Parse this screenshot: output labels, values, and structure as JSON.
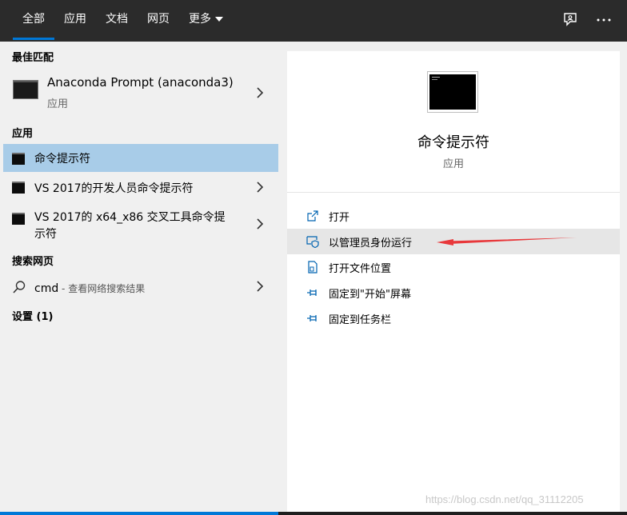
{
  "tabs": [
    {
      "label": "全部",
      "active": true
    },
    {
      "label": "应用"
    },
    {
      "label": "文档"
    },
    {
      "label": "网页"
    },
    {
      "label": "更多"
    }
  ],
  "header_icons": [
    "feedback-icon",
    "more-options-icon"
  ],
  "best_match": {
    "title": "最佳匹配",
    "item": {
      "name": "Anaconda Prompt (anaconda3)",
      "type": "应用",
      "icon": "terminal-icon"
    }
  },
  "apps": {
    "title": "应用",
    "items": [
      {
        "name": "命令提示符",
        "selected": true
      },
      {
        "name": "VS 2017的开发人员命令提示符"
      },
      {
        "name_line1": "VS 2017的 x64_x86 交叉工具命令提",
        "name_line2": "示符"
      }
    ]
  },
  "web": {
    "title": "搜索网页",
    "query": "cmd",
    "suffix": " - 查看网络搜索结果"
  },
  "settings": {
    "title": "设置 (1)"
  },
  "preview": {
    "name": "命令提示符",
    "type": "应用"
  },
  "actions": [
    {
      "label": "打开",
      "icon": "open-icon"
    },
    {
      "label": "以管理员身份运行",
      "icon": "shield-icon",
      "highlighted": true
    },
    {
      "label": "打开文件位置",
      "icon": "file-location-icon"
    },
    {
      "label": "固定到\"开始\"屏幕",
      "icon": "pin-icon"
    },
    {
      "label": "固定到任务栏",
      "icon": "pin-icon"
    }
  ],
  "watermark": "https://blog.csdn.net/qq_31112205",
  "colors": {
    "topbar": "#2b2b2b",
    "accent": "#0078d7",
    "selected_row": "#a8cce8",
    "highlight_row": "#e6e6e6",
    "arrow": "#e8383b"
  }
}
